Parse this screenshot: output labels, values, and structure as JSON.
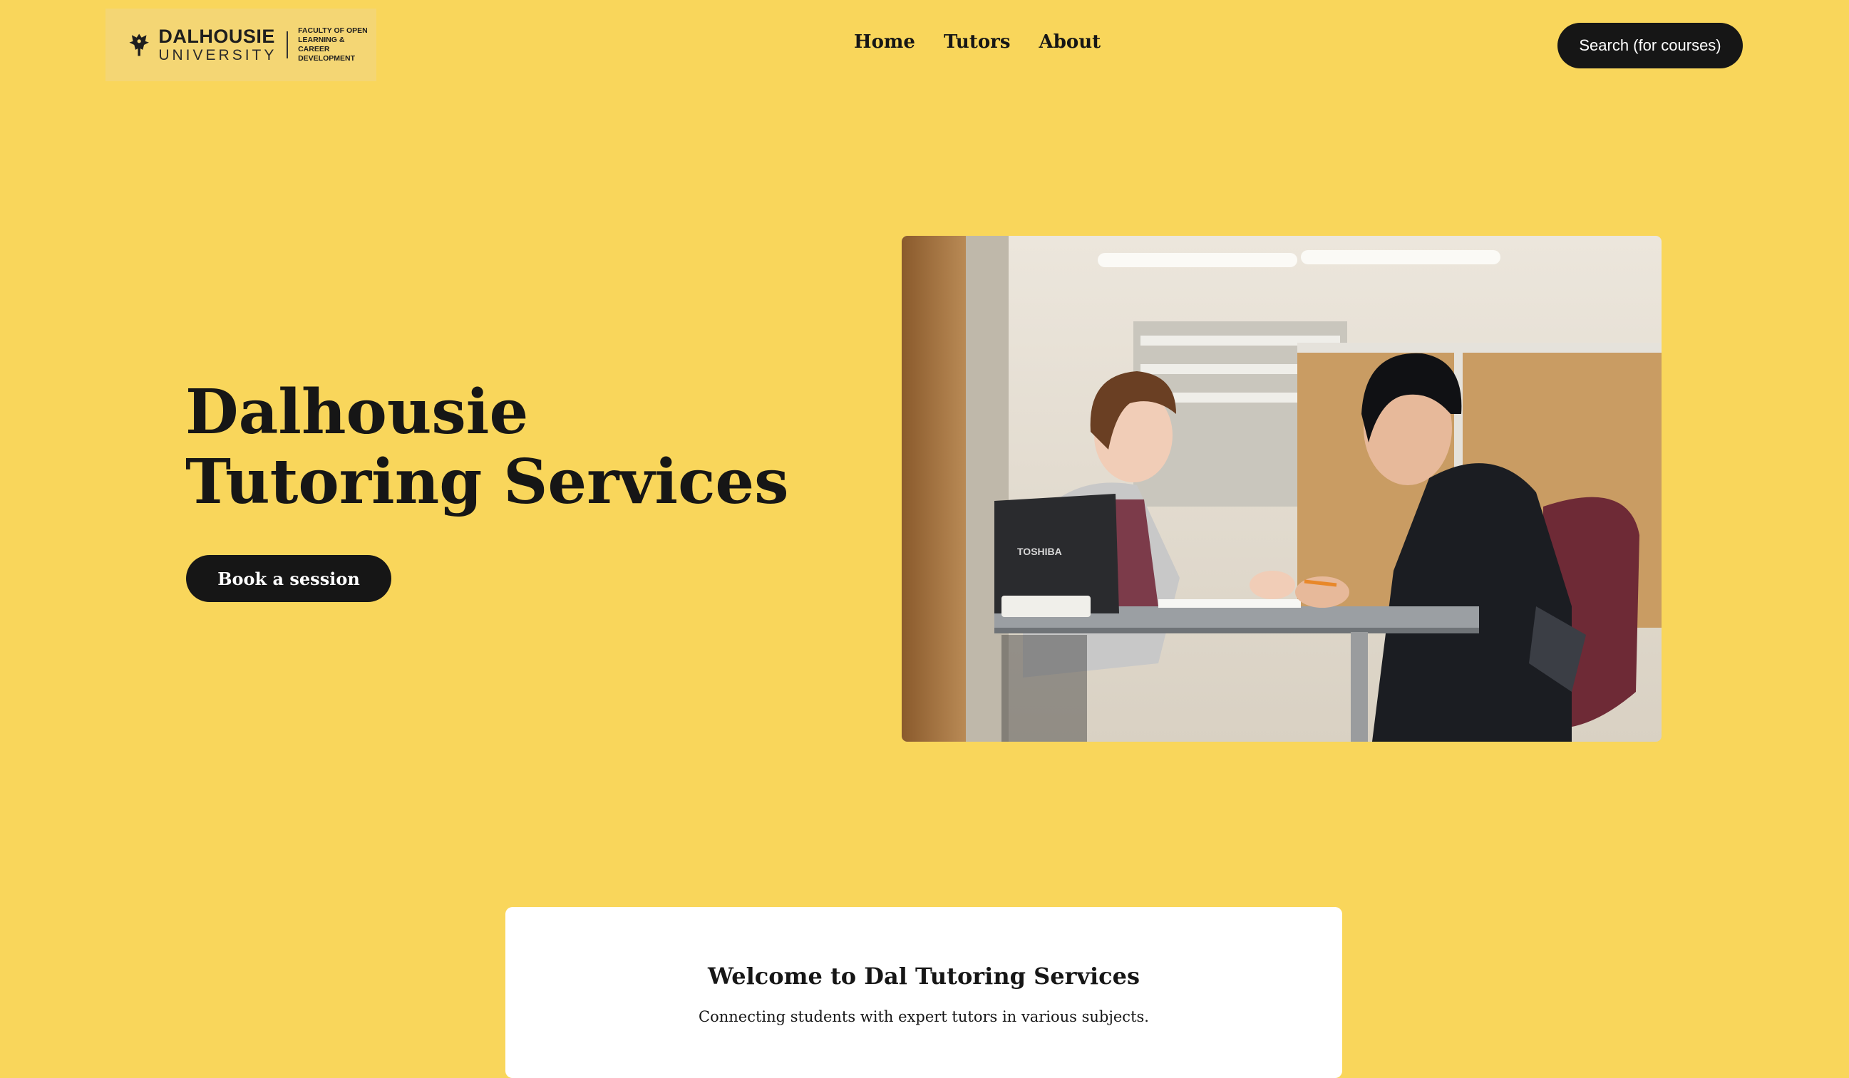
{
  "brand": {
    "university_line1": "DALHOUSIE",
    "university_line2": "UNIVERSITY",
    "faculty": "FACULTY OF OPEN LEARNING & CAREER DEVELOPMENT"
  },
  "nav": {
    "items": [
      "Home",
      "Tutors",
      "About"
    ]
  },
  "header": {
    "search_label": "Search (for courses)"
  },
  "hero": {
    "title_line1": "Dalhousie",
    "title_line2": "Tutoring Services",
    "cta_label": "Book a session",
    "photo_laptop_brand": "TOSHIBA"
  },
  "welcome": {
    "title": "Welcome to Dal Tutoring Services",
    "subtitle": "Connecting students with expert tutors in various subjects."
  },
  "colors": {
    "background": "#f9d65b",
    "button": "#161616",
    "card": "#ffffff"
  }
}
